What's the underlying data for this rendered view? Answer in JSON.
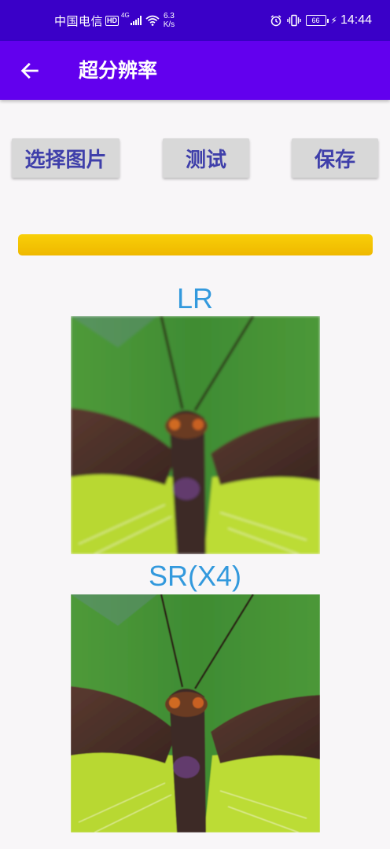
{
  "status_bar": {
    "carrier": "中国电信",
    "hd_badge": "HD",
    "network_type": "4G",
    "speed_value": "6.3",
    "speed_unit": "K/s",
    "battery": "66",
    "time": "14:44",
    "icons": [
      "signal-icon",
      "wifi-icon",
      "alarm-icon",
      "vibrate-icon",
      "battery-icon",
      "charging-icon"
    ]
  },
  "app_bar": {
    "title": "超分辨率",
    "back_icon": "arrow-left-icon",
    "background": "#6200ee"
  },
  "buttons": {
    "select_label": "选择图片",
    "test_label": "测试",
    "save_label": "保存"
  },
  "progress": {
    "value": 1.0,
    "color": "#f5c400"
  },
  "images": {
    "lr_label": "LR",
    "sr_label": "SR(X4)"
  },
  "colors": {
    "status_bar": "#3a00c8",
    "button_text": "#3f3faa",
    "button_bg": "#d8d8d8",
    "image_label": "#3399dd",
    "background": "#f8f6f8"
  }
}
